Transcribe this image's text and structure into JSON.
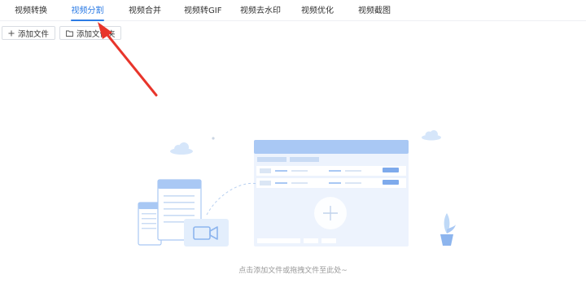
{
  "tabs": [
    {
      "label": "视频转换",
      "active": false
    },
    {
      "label": "视频分割",
      "active": true
    },
    {
      "label": "视频合并",
      "active": false
    },
    {
      "label": "视频转GIF",
      "active": false
    },
    {
      "label": "视频去水印",
      "active": false
    },
    {
      "label": "视频优化",
      "active": false
    },
    {
      "label": "视频截图",
      "active": false
    }
  ],
  "toolbar": {
    "add_file_label": "添加文件",
    "add_folder_label": "添加文件夹"
  },
  "drop_zone": {
    "hint": "点击添加文件或拖拽文件至此处~"
  },
  "colors": {
    "accent": "#2c7be5",
    "arrow": "#e8352b",
    "illustration_blue": "#a9c8f4",
    "illustration_light": "#e8f1fd"
  }
}
